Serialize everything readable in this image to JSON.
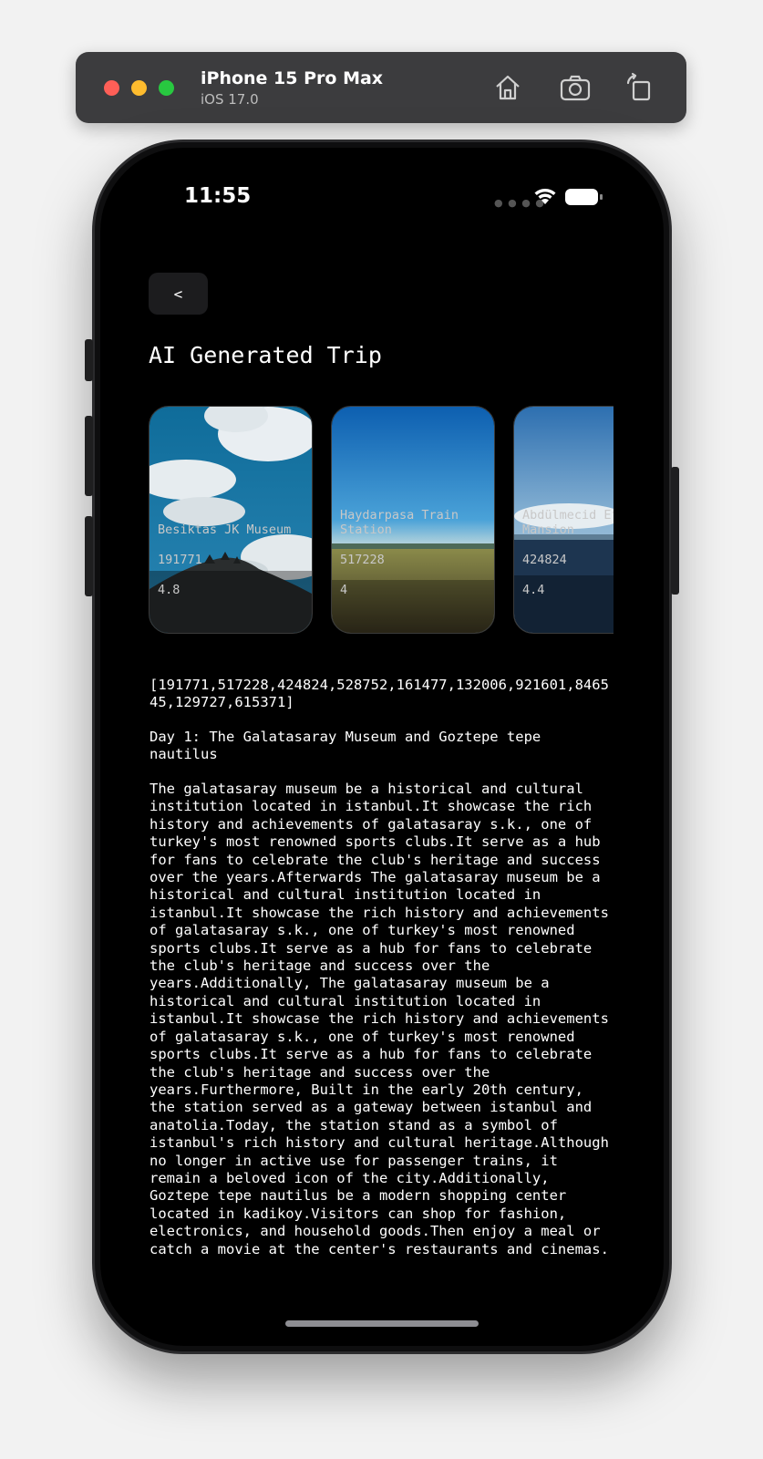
{
  "simulator": {
    "device_name": "iPhone 15 Pro Max",
    "os_version": "iOS 17.0",
    "toolbar_icons": [
      "home-icon",
      "screenshot-icon",
      "rotate-icon"
    ]
  },
  "status_bar": {
    "time": "11:55"
  },
  "header": {
    "back_label": "<",
    "title": "AI Generated Trip"
  },
  "places": [
    {
      "name": "Besiktas JK Museum",
      "id": "191771",
      "rating": "4.8"
    },
    {
      "name": "Haydarpasa Train Station",
      "id": "517228",
      "rating": "4"
    },
    {
      "name": "Abdülmecid Efendi Mansion",
      "id": "424824",
      "rating": "4.4"
    }
  ],
  "place_ids_text": "[191771,517228,424824,528752,161477,132006,921601,846545,129727,615371]",
  "day": {
    "title": "Day 1: The Galatasaray Museum and Goztepe tepe nautilus",
    "description": "The galatasaray museum be a historical and cultural institution located in istanbul.It showcase the rich history and achievements of galatasaray s.k., one of turkey's most renowned sports clubs.It serve as a hub for fans to celebrate the club's heritage and success over the years.Afterwards The galatasaray museum be a historical and cultural institution located in istanbul.It showcase the rich history and achievements of galatasaray s.k., one of turkey's most renowned sports clubs.It serve as a hub for fans to celebrate the club's heritage and success over the years.Additionally, The galatasaray museum be a historical and cultural institution located in istanbul.It showcase the rich history and achievements of galatasaray s.k., one of turkey's most renowned sports clubs.It serve as a hub for fans to celebrate the club's heritage and success over the years.Furthermore, Built in the early 20th century, the station served as a gateway between istanbul and anatolia.Today, the station stand as a symbol of istanbul's rich history and cultural heritage.Although no longer in active use for passenger trains, it remain a beloved icon of the city.Additionally, Goztepe tepe nautilus be a modern shopping center located in kadikoy.Visitors can shop for fashion, electronics, and household goods.Then enjoy a meal or catch a movie at the center's restaurants and cinemas."
  }
}
